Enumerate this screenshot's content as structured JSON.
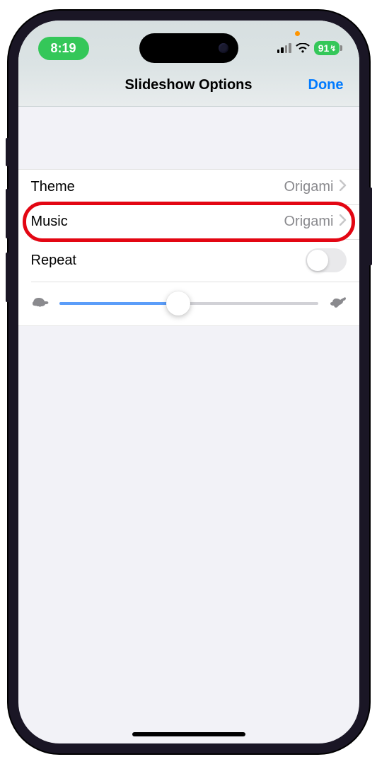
{
  "status_bar": {
    "time": "8:19",
    "battery": "91"
  },
  "header": {
    "title": "Slideshow Options",
    "done_label": "Done"
  },
  "options": {
    "theme": {
      "label": "Theme",
      "value": "Origami"
    },
    "music": {
      "label": "Music",
      "value": "Origami"
    },
    "repeat": {
      "label": "Repeat",
      "enabled": false
    },
    "speed": {
      "value_percent": 46
    }
  }
}
